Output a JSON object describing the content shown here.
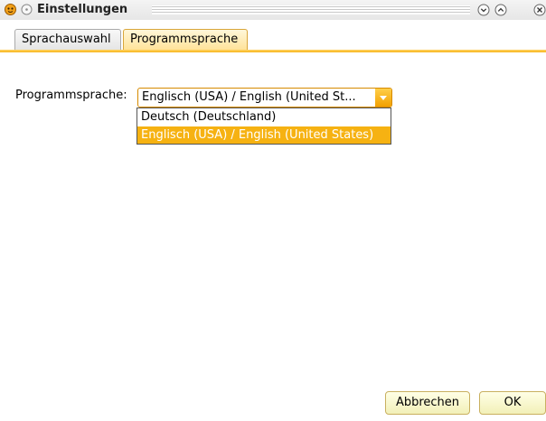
{
  "window": {
    "title": "Einstellungen"
  },
  "tabs": [
    {
      "label": "Sprachauswahl",
      "selected": false
    },
    {
      "label": "Programmsprache",
      "selected": true
    }
  ],
  "form": {
    "label": "Programmsprache:",
    "selected_value": "Englisch (USA) / English (United St...",
    "options": [
      {
        "label": "Deutsch (Deutschland)",
        "highlighted": false
      },
      {
        "label": "Englisch (USA) / English (United States)",
        "highlighted": true
      }
    ]
  },
  "buttons": {
    "cancel": "Abbrechen",
    "ok": "OK"
  },
  "colors": {
    "accent": "#f6b212",
    "tab_active": "#ffe39a"
  },
  "icons": [
    "app-icon",
    "menu-icon",
    "minimize-icon",
    "maximize-icon",
    "close-icon",
    "chevron-down-icon"
  ]
}
